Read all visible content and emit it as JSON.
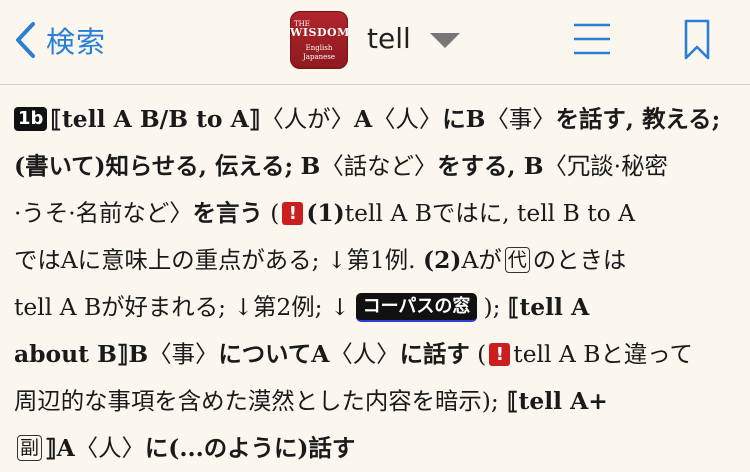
{
  "nav": {
    "back_label": "検索",
    "app_icon": {
      "line1": "THE",
      "line2": "WISDOM",
      "line3": "English",
      "line4": "Japanese"
    },
    "title": "tell",
    "accent_color": "#2a7fd5"
  },
  "entry": {
    "sense_badge": "1b",
    "l1": {
      "pattern": "⟦tell A B/B to A⟧",
      "t1": "〈人が〉",
      "b1": "A",
      "t2": "〈人〉",
      "b2": "にB",
      "t3": "〈事〉",
      "b3": "を話す, 教える;"
    },
    "l2": {
      "b1": "(書いて)知らせる, 伝える;",
      "b2": "B",
      "t1": "〈話など〉",
      "b3": "をする, B",
      "t2": "〈冗談·秘密"
    },
    "l3": {
      "t1": "·うそ·名前など〉",
      "b1": "を言う",
      "t2": " (",
      "note": "!",
      "b2": "(1)",
      "t3": "tell A Bではに, tell B to A"
    },
    "l4": {
      "t1": "ではAに意味上の重点がある; ↓第1例.",
      "b1": "(2)",
      "t2": "Aが",
      "box": "代",
      "t3": "のときは"
    },
    "l5": {
      "t1": "tell A Bが好まれる; ↓第2例; ↓",
      "corpus": "コーパスの窓",
      "t2": "); ",
      "b1": "⟦tell A"
    },
    "l6": {
      "b1": "about B⟧B",
      "t1": "〈事〉",
      "b2": "についてA",
      "t2": "〈人〉",
      "b3": "に話す",
      "t3": " (",
      "note": "!",
      "t4": "tell A Bと違って"
    },
    "l7": {
      "t1": "周辺的な事項を含めた漠然とした内容を暗示);",
      "b1": " ⟦tell A+"
    },
    "l8": {
      "box": "副",
      "b1": "⟧A",
      "t1": "〈人〉",
      "b2": "に(...のように)話す"
    }
  }
}
